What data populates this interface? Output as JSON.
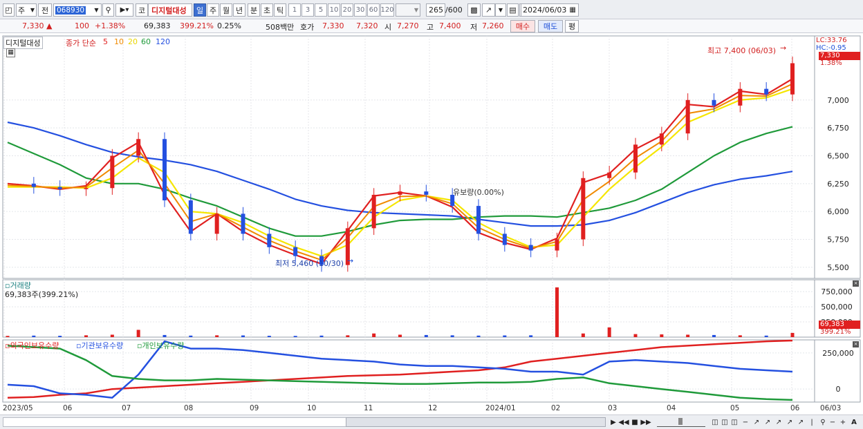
{
  "toolbar": {
    "market_select": "주",
    "prev_label": "전",
    "stock_code": "068930",
    "market_type": "코",
    "stock_name": "디지털대성",
    "periods": [
      "일",
      "주",
      "월",
      "년",
      "분",
      "초",
      "틱"
    ],
    "active_period": "일",
    "intervals": [
      "1",
      "3",
      "5",
      "10",
      "20",
      "30",
      "60",
      "120"
    ],
    "count_display": "265",
    "count_total": "/600",
    "date": "2024/06/03"
  },
  "quote": {
    "price": "7,330",
    "change": "100",
    "change_pct": "+1.38%",
    "volume": "69,383",
    "volume_pct": "399.21%",
    "turnover": "0.25%",
    "amount": "508백만",
    "hoga_label": "호가",
    "ask": "7,330",
    "bid": "7,320",
    "open_label": "시",
    "open": "7,270",
    "high_label": "고",
    "high": "7,400",
    "low_label": "저",
    "low": "7,260",
    "buy_label": "매수",
    "sell_label": "매도",
    "flat_label": "평"
  },
  "price_panel": {
    "title": "디지털대성",
    "ma_label": "종가 단순",
    "ma_periods": [
      "5",
      "10",
      "20",
      "60",
      "120"
    ],
    "ma_colors": [
      "#e02020",
      "#f08a00",
      "#f5e600",
      "#1f9a3a",
      "#2450e0"
    ],
    "high_annotation": "최고 7,400 (06/03)",
    "low_annotation": "최저 5,460 (10/30)",
    "mid_annotation": "유보량(0.00%)",
    "lc_label": "LC:33.76",
    "hc_label": "HC:-0.95",
    "price_tag": "7,330",
    "pct_tag": "1.38%"
  },
  "volume_panel": {
    "title": "거래량",
    "value": "69,383주(399.21%)",
    "tag": "69,383",
    "tag_pct": "399.21%"
  },
  "holding_panel": {
    "series_labels": [
      "외국인보유수량",
      "기관보유수량",
      "개인보유수량"
    ],
    "series_colors": [
      "#e02020",
      "#2450e0",
      "#1f9a3a"
    ]
  },
  "x_axis": [
    "2023/05",
    "06",
    "07",
    "08",
    "09",
    "10",
    "11",
    "12",
    "2024/01",
    "02",
    "03",
    "04",
    "05",
    "06"
  ],
  "x_axis_end": "06/03",
  "chart_data": {
    "type": "line",
    "title": "",
    "price_axis": {
      "ticks": [
        7000,
        6750,
        6500,
        6250,
        6000,
        5750,
        5500
      ],
      "range": [
        5400,
        7550
      ]
    },
    "volume_axis": {
      "ticks": [
        "750,000",
        "500,000",
        "250,000"
      ],
      "range": [
        0,
        900000
      ]
    },
    "holding_axis": {
      "ticks": [
        "250,000",
        "0"
      ],
      "range": [
        -90000,
        340000
      ]
    },
    "months": [
      "2023/05",
      "06",
      "07",
      "08",
      "09",
      "10",
      "11",
      "12",
      "2024/01",
      "02",
      "03",
      "04",
      "05",
      "06"
    ],
    "close": [
      6250,
      6220,
      6200,
      6210,
      6500,
      6650,
      6100,
      5800,
      5980,
      5800,
      5680,
      5600,
      5520,
      5850,
      6150,
      6180,
      6150,
      6050,
      5800,
      5700,
      5650,
      5750,
      6300,
      6350,
      6600,
      6700,
      7000,
      6950,
      7100,
      7050,
      7330
    ],
    "ma5": [
      6250,
      6230,
      6200,
      6230,
      6480,
      6620,
      6150,
      5820,
      5980,
      5820,
      5700,
      5610,
      5530,
      5830,
      6140,
      6170,
      6140,
      6040,
      5810,
      5720,
      5660,
      5760,
      6260,
      6340,
      6560,
      6680,
      6960,
      6940,
      7080,
      7050,
      7190
    ],
    "ma20": [
      6220,
      6220,
      6220,
      6210,
      6300,
      6480,
      6350,
      6000,
      5980,
      5900,
      5780,
      5680,
      5600,
      5700,
      5950,
      6100,
      6140,
      6100,
      5900,
      5780,
      5680,
      5700,
      5950,
      6200,
      6400,
      6580,
      6800,
      6900,
      7000,
      7020,
      7100
    ],
    "ma60": [
      6620,
      6520,
      6420,
      6300,
      6250,
      6250,
      6200,
      6120,
      6050,
      5950,
      5850,
      5780,
      5780,
      5820,
      5880,
      5920,
      5930,
      5930,
      5950,
      5960,
      5960,
      5950,
      5990,
      6030,
      6100,
      6200,
      6350,
      6500,
      6620,
      6700,
      6760
    ],
    "ma120": [
      6800,
      6750,
      6680,
      6600,
      6530,
      6490,
      6460,
      6420,
      6360,
      6280,
      6200,
      6110,
      6050,
      6010,
      5990,
      5980,
      5970,
      5960,
      5930,
      5900,
      5870,
      5870,
      5880,
      5920,
      5990,
      6080,
      6170,
      6240,
      6290,
      6320,
      6360
    ],
    "volume": [
      20000,
      25000,
      22000,
      30000,
      40000,
      120000,
      35000,
      25000,
      30000,
      28000,
      22000,
      20000,
      25000,
      30000,
      60000,
      40000,
      35000,
      30000,
      25000,
      28000,
      30000,
      820000,
      60000,
      160000,
      50000,
      45000,
      40000,
      35000,
      30000,
      25000,
      69383
    ],
    "holding_series": [
      {
        "name": "외국인보유수량",
        "values": [
          -60000,
          -55000,
          -40000,
          -30000,
          0,
          10000,
          20000,
          30000,
          40000,
          50000,
          60000,
          70000,
          80000,
          90000,
          95000,
          100000,
          110000,
          120000,
          130000,
          150000,
          190000,
          210000,
          230000,
          250000,
          270000,
          290000,
          300000,
          310000,
          320000,
          330000,
          335000
        ]
      },
      {
        "name": "기관보유수량",
        "values": [
          30000,
          20000,
          -30000,
          -40000,
          -60000,
          100000,
          330000,
          280000,
          280000,
          270000,
          250000,
          230000,
          210000,
          200000,
          190000,
          170000,
          160000,
          160000,
          150000,
          140000,
          120000,
          120000,
          100000,
          190000,
          200000,
          190000,
          180000,
          160000,
          140000,
          130000,
          120000
        ]
      },
      {
        "name": "개인보유수량",
        "values": [
          300000,
          290000,
          280000,
          200000,
          90000,
          70000,
          60000,
          60000,
          70000,
          65000,
          60000,
          55000,
          50000,
          45000,
          40000,
          35000,
          35000,
          40000,
          45000,
          45000,
          50000,
          70000,
          80000,
          40000,
          20000,
          0,
          -20000,
          -40000,
          -60000,
          -70000,
          -75000
        ]
      }
    ]
  }
}
